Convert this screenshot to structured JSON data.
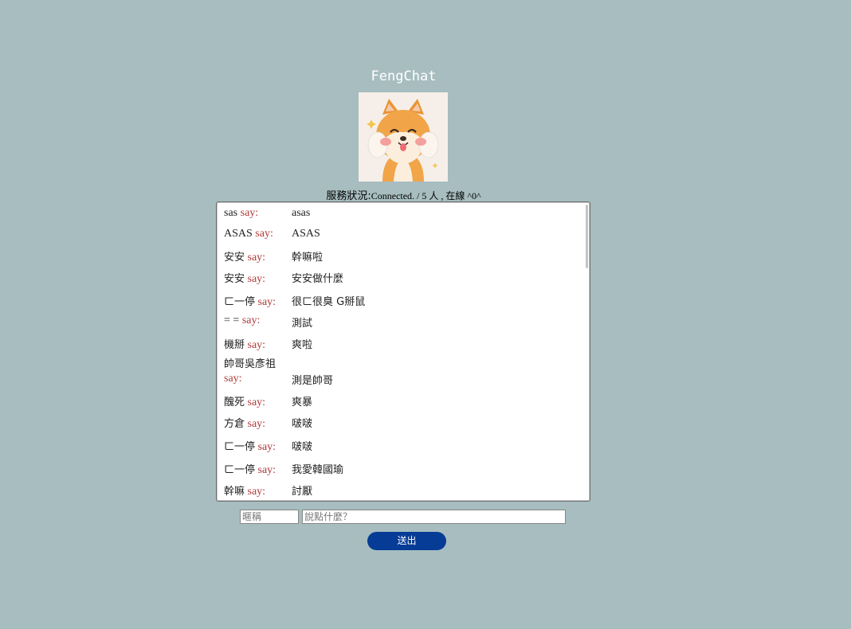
{
  "app": {
    "title": "FengChat"
  },
  "status": {
    "label": "服務狀況:",
    "value": "Connected. / 5 人 , 在線 ^0^"
  },
  "messages": [
    {
      "name": "sas",
      "say": "say:",
      "text": "asas"
    },
    {
      "name": "ASAS",
      "say": "say:",
      "text": "ASAS"
    },
    {
      "name": "安安",
      "say": "say:",
      "text": "幹嘛啦"
    },
    {
      "name": "安安",
      "say": "say:",
      "text": "安安做什麼"
    },
    {
      "name": "ㄈ一停",
      "say": "say:",
      "text": "很ㄈ很臭 G掰鼠"
    },
    {
      "name": "= =",
      "say": "say:",
      "text": "測試"
    },
    {
      "name": "機掰",
      "say": "say:",
      "text": "爽啦"
    },
    {
      "name": "帥哥吳彥祖",
      "say": "say:",
      "text": "測是帥哥"
    },
    {
      "name": "醜死",
      "say": "say:",
      "text": "爽暴"
    },
    {
      "name": "方倉",
      "say": "say:",
      "text": "啵啵"
    },
    {
      "name": "ㄈ一停",
      "say": "say:",
      "text": "啵啵"
    },
    {
      "name": "ㄈ一停",
      "say": "say:",
      "text": "我愛韓國瑜"
    },
    {
      "name": "幹嘛",
      "say": "say:",
      "text": "討厭"
    }
  ],
  "form": {
    "nickname_placeholder": "暱稱",
    "message_placeholder": "說點什麼？",
    "send_label": "送出"
  },
  "colors": {
    "background": "#a7bdbf",
    "say": "#b13a3a",
    "button": "#063b96"
  }
}
